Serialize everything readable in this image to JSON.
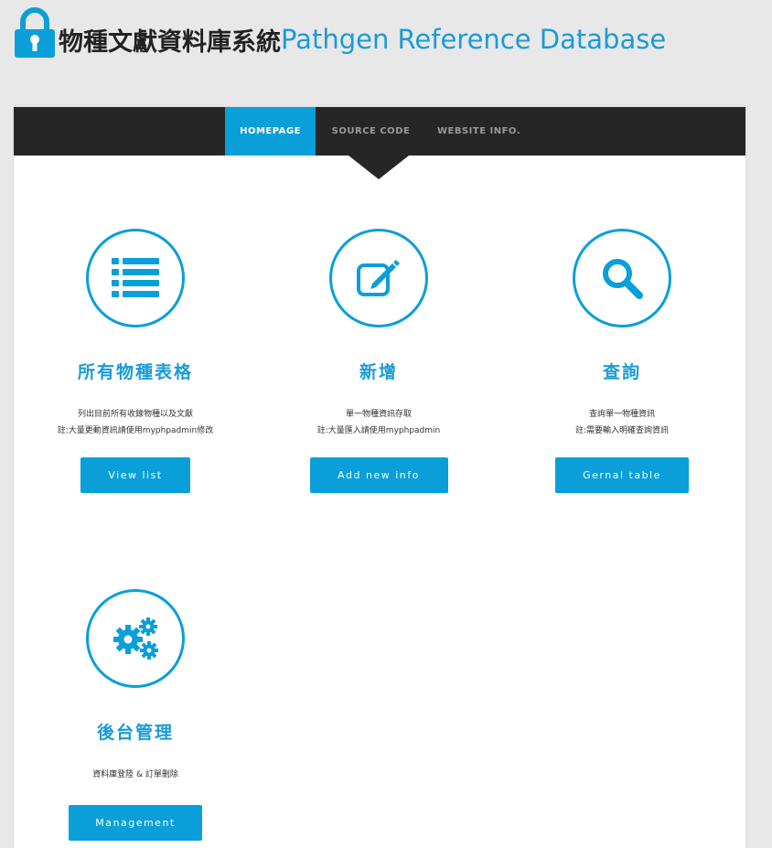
{
  "header": {
    "title_cn": "物種文獻資料庫系統",
    "title_en": "Pathgen Reference Database",
    "icon": "lock-icon"
  },
  "nav": {
    "items": [
      {
        "label": "HOMEPAGE",
        "active": true
      },
      {
        "label": "SOURCE CODE",
        "active": false
      },
      {
        "label": "WEBSITE INFO.",
        "active": false
      }
    ]
  },
  "features": [
    {
      "icon": "list-icon",
      "title": "所有物種表格",
      "desc1": "列出目前所有收錄物種以及文獻",
      "desc2": "註:大量更動資訊請使用myphpadmin修改",
      "button": "View list"
    },
    {
      "icon": "edit-icon",
      "title": "新增",
      "desc1": "單一物種資訊存取",
      "desc2": "註:大量匯入請使用myphpadmin",
      "button": "Add new info"
    },
    {
      "icon": "search-icon",
      "title": "查詢",
      "desc1": "查詢單一物種資訊",
      "desc2": "註:需要輸入明確查詢資訊",
      "button": "Gernal table"
    },
    {
      "icon": "gears-icon",
      "title": "後台管理",
      "desc1": "資料庫登陸 & 訂單刪除",
      "desc2": "",
      "button": "Management"
    }
  ],
  "colors": {
    "accent": "#0a9fd8",
    "navbar": "#262626",
    "background": "#e8e8e8"
  }
}
